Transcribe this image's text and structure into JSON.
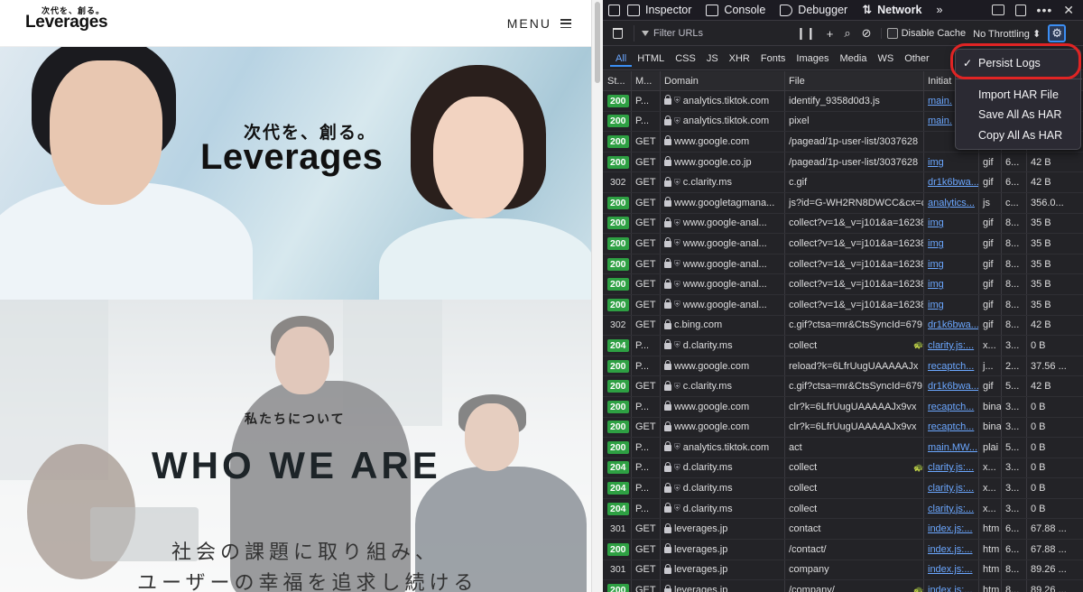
{
  "site": {
    "logo_tagline": "次代を、創る。",
    "logo_word": "Leverages",
    "menu_label": "MENU",
    "hero_tagline": "次代を、創る。",
    "hero_word": "Leverages",
    "about_heading": "私たちについて",
    "about_big": "WHO WE ARE",
    "about_line1": "社会の課題に取り組み、",
    "about_line2": "ユーザーの幸福を追求し続ける"
  },
  "devtools": {
    "tabs": [
      {
        "label": "Inspector",
        "icon": "inspector-icon"
      },
      {
        "label": "Console",
        "icon": "console-icon"
      },
      {
        "label": "Debugger",
        "icon": "debugger-icon"
      },
      {
        "label": "Network",
        "icon": "network-icon"
      }
    ],
    "more_tabs": "»",
    "toolbar": {
      "filter_placeholder": "Filter URLs",
      "pause": "❙❙",
      "add": "+",
      "disable_cache": "Disable Cache",
      "throttling": "No Throttling ⬍"
    },
    "types": [
      "All",
      "HTML",
      "CSS",
      "JS",
      "XHR",
      "Fonts",
      "Images",
      "Media",
      "WS",
      "Other"
    ],
    "columns": [
      "St...",
      "M...",
      "Domain",
      "File",
      "Initiat",
      "",
      "",
      ""
    ],
    "rows": [
      {
        "status": "200",
        "method": "P...",
        "domain": "analytics.tiktok.com",
        "tracker": true,
        "file": "identify_9358d0d3.js",
        "initiator": "main.",
        "type": "",
        "transfer": "",
        "size": ""
      },
      {
        "status": "200",
        "method": "P...",
        "domain": "analytics.tiktok.com",
        "tracker": true,
        "file": "pixel",
        "initiator": "main.",
        "type": "",
        "transfer": "",
        "size": ""
      },
      {
        "status": "200",
        "method": "GET",
        "domain": "www.google.com",
        "tracker": false,
        "file": "/pagead/1p-user-list/3037628",
        "initiator": "",
        "type": "",
        "transfer": "",
        "size": ""
      },
      {
        "status": "200",
        "method": "GET",
        "domain": "www.google.co.jp",
        "tracker": false,
        "file": "/pagead/1p-user-list/3037628",
        "initiator": "img",
        "type": "gif",
        "transfer": "6...",
        "size": "42 B"
      },
      {
        "status": "302",
        "method": "GET",
        "domain": "c.clarity.ms",
        "tracker": true,
        "file": "c.gif",
        "initiator": "dr1k6bwa...",
        "type": "gif",
        "transfer": "6...",
        "size": "42 B"
      },
      {
        "status": "200",
        "method": "GET",
        "domain": "www.googletagmana...",
        "tracker": false,
        "file": "js?id=G-WH2RN8DWCC&cx=c",
        "initiator": "analytics...",
        "type": "js",
        "transfer": "c...",
        "size": "356.0..."
      },
      {
        "status": "200",
        "method": "GET",
        "domain": "www.google-anal...",
        "tracker": true,
        "file": "collect?v=1&_v=j101&a=16238",
        "initiator": "img",
        "type": "gif",
        "transfer": "8...",
        "size": "35 B"
      },
      {
        "status": "200",
        "method": "GET",
        "domain": "www.google-anal...",
        "tracker": true,
        "file": "collect?v=1&_v=j101&a=16238",
        "initiator": "img",
        "type": "gif",
        "transfer": "8...",
        "size": "35 B"
      },
      {
        "status": "200",
        "method": "GET",
        "domain": "www.google-anal...",
        "tracker": true,
        "file": "collect?v=1&_v=j101&a=16238",
        "initiator": "img",
        "type": "gif",
        "transfer": "8...",
        "size": "35 B"
      },
      {
        "status": "200",
        "method": "GET",
        "domain": "www.google-anal...",
        "tracker": true,
        "file": "collect?v=1&_v=j101&a=16238",
        "initiator": "img",
        "type": "gif",
        "transfer": "8...",
        "size": "35 B"
      },
      {
        "status": "200",
        "method": "GET",
        "domain": "www.google-anal...",
        "tracker": true,
        "file": "collect?v=1&_v=j101&a=16238",
        "initiator": "img",
        "type": "gif",
        "transfer": "8...",
        "size": "35 B"
      },
      {
        "status": "302",
        "method": "GET",
        "domain": "c.bing.com",
        "tracker": false,
        "file": "c.gif?ctsa=mr&CtsSyncId=679",
        "initiator": "dr1k6bwa...",
        "type": "gif",
        "transfer": "8...",
        "size": "42 B"
      },
      {
        "status": "204",
        "method": "P...",
        "domain": "d.clarity.ms",
        "tracker": true,
        "file": "collect",
        "initiator": "clarity.js:...",
        "type": "x...",
        "transfer": "3...",
        "size": "0 B",
        "slow": true
      },
      {
        "status": "200",
        "method": "P...",
        "domain": "www.google.com",
        "tracker": false,
        "file": "reload?k=6LfrUugUAAAAAJx",
        "initiator": "recaptch...",
        "type": "j...",
        "transfer": "2...",
        "size": "37.56 ..."
      },
      {
        "status": "200",
        "method": "GET",
        "domain": "c.clarity.ms",
        "tracker": true,
        "file": "c.gif?ctsa=mr&CtsSyncId=679",
        "initiator": "dr1k6bwa...",
        "type": "gif",
        "transfer": "5...",
        "size": "42 B"
      },
      {
        "status": "200",
        "method": "P...",
        "domain": "www.google.com",
        "tracker": false,
        "file": "clr?k=6LfrUugUAAAAAJx9vx",
        "initiator": "recaptch...",
        "type": "bina",
        "transfer": "3...",
        "size": "0 B"
      },
      {
        "status": "200",
        "method": "GET",
        "domain": "www.google.com",
        "tracker": false,
        "file": "clr?k=6LfrUugUAAAAAJx9vx",
        "initiator": "recaptch...",
        "type": "bina",
        "transfer": "3...",
        "size": "0 B"
      },
      {
        "status": "200",
        "method": "P...",
        "domain": "analytics.tiktok.com",
        "tracker": true,
        "file": "act",
        "initiator": "main.MW...",
        "type": "plai",
        "transfer": "5...",
        "size": "0 B"
      },
      {
        "status": "204",
        "method": "P...",
        "domain": "d.clarity.ms",
        "tracker": true,
        "file": "collect",
        "initiator": "clarity.js:...",
        "type": "x...",
        "transfer": "3...",
        "size": "0 B",
        "slow": true
      },
      {
        "status": "204",
        "method": "P...",
        "domain": "d.clarity.ms",
        "tracker": true,
        "file": "collect",
        "initiator": "clarity.js:...",
        "type": "x...",
        "transfer": "3...",
        "size": "0 B"
      },
      {
        "status": "204",
        "method": "P...",
        "domain": "d.clarity.ms",
        "tracker": true,
        "file": "collect",
        "initiator": "clarity.js:...",
        "type": "x...",
        "transfer": "3...",
        "size": "0 B"
      },
      {
        "status": "301",
        "method": "GET",
        "domain": "leverages.jp",
        "tracker": false,
        "file": "contact",
        "initiator": "index.js:...",
        "type": "htm",
        "transfer": "6...",
        "size": "67.88 ..."
      },
      {
        "status": "200",
        "method": "GET",
        "domain": "leverages.jp",
        "tracker": false,
        "file": "/contact/",
        "initiator": "index.js:...",
        "type": "htm",
        "transfer": "6...",
        "size": "67.88 ..."
      },
      {
        "status": "301",
        "method": "GET",
        "domain": "leverages.jp",
        "tracker": false,
        "file": "company",
        "initiator": "index.js:...",
        "type": "htm",
        "transfer": "8...",
        "size": "89.26 ..."
      },
      {
        "status": "200",
        "method": "GET",
        "domain": "leverages.jp",
        "tracker": false,
        "file": "/company/",
        "initiator": "index.js:...",
        "type": "htm",
        "transfer": "8...",
        "size": "89.26 ...",
        "slow": true
      }
    ],
    "menu": {
      "persist_logs": "Persist Logs",
      "import_har": "Import HAR File",
      "save_har": "Save All As HAR",
      "copy_har": "Copy All As HAR"
    }
  },
  "colors": {
    "status_ok": "#2ea043",
    "accent": "#3b8ef3",
    "highlight": "#e02424"
  }
}
